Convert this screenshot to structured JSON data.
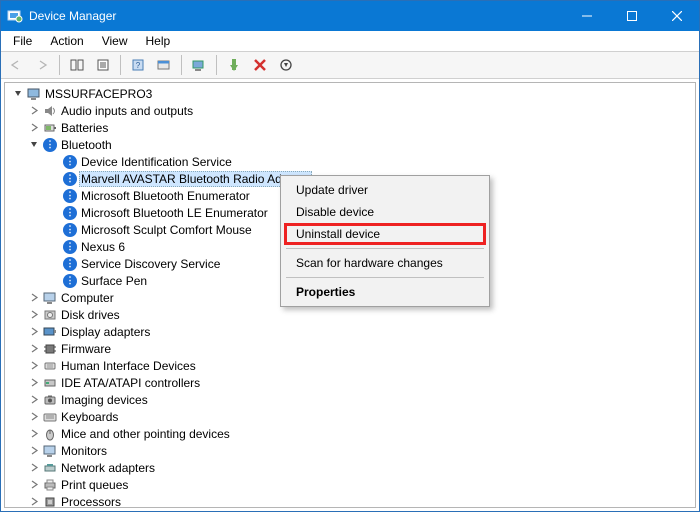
{
  "window": {
    "title": "Device Manager"
  },
  "menu": {
    "file": "File",
    "action": "Action",
    "view": "View",
    "help": "Help"
  },
  "tree": {
    "root": "MSSURFACEPRO3",
    "cat_audio": "Audio inputs and outputs",
    "cat_batteries": "Batteries",
    "cat_bluetooth": "Bluetooth",
    "bt_devident": "Device Identification Service",
    "bt_marvell": "Marvell AVASTAR Bluetooth Radio Adapter",
    "bt_enum": "Microsoft Bluetooth Enumerator",
    "bt_leenum": "Microsoft Bluetooth LE Enumerator",
    "bt_mouse": "Microsoft Sculpt Comfort Mouse",
    "bt_nexus": "Nexus 6",
    "bt_sds": "Service Discovery Service",
    "bt_pen": "Surface Pen",
    "cat_computer": "Computer",
    "cat_disk": "Disk drives",
    "cat_display": "Display adapters",
    "cat_firmware": "Firmware",
    "cat_hid": "Human Interface Devices",
    "cat_ide": "IDE ATA/ATAPI controllers",
    "cat_imaging": "Imaging devices",
    "cat_keyboards": "Keyboards",
    "cat_mice": "Mice and other pointing devices",
    "cat_monitors": "Monitors",
    "cat_netadapters": "Network adapters",
    "cat_printq": "Print queues",
    "cat_processors": "Processors"
  },
  "context_menu": {
    "update": "Update driver",
    "disable": "Disable device",
    "uninstall": "Uninstall device",
    "scan": "Scan for hardware changes",
    "properties": "Properties"
  }
}
